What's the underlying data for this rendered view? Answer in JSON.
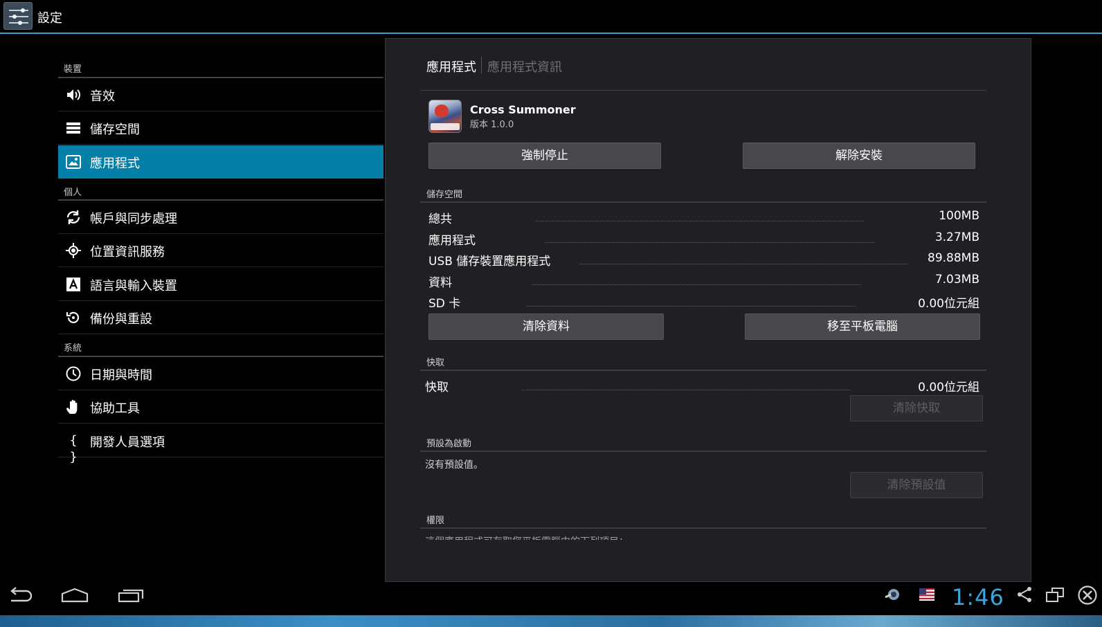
{
  "window": {
    "title": "設定"
  },
  "sidebar": {
    "sections": [
      {
        "header": "裝置"
      },
      {
        "header": "個人"
      },
      {
        "header": "系統"
      }
    ],
    "items": [
      {
        "label": "音效",
        "icon": "speaker-icon"
      },
      {
        "label": "儲存空間",
        "icon": "storage-icon"
      },
      {
        "label": "應用程式",
        "icon": "apps-icon",
        "selected": true
      },
      {
        "label": "帳戶與同步處理",
        "icon": "sync-icon"
      },
      {
        "label": "位置資訊服務",
        "icon": "location-icon"
      },
      {
        "label": "語言與輸入裝置",
        "icon": "language-icon"
      },
      {
        "label": "備份與重設",
        "icon": "backup-icon"
      },
      {
        "label": "日期與時間",
        "icon": "clock-icon"
      },
      {
        "label": "協助工具",
        "icon": "hand-icon"
      },
      {
        "label": "開發人員選項",
        "icon": "braces-icon"
      }
    ],
    "selected_color": "#0480a8"
  },
  "detail": {
    "breadcrumb": {
      "parent": "應用程式",
      "current": "應用程式資訊"
    },
    "app": {
      "name": "Cross Summoner",
      "version": "版本 1.0.0"
    },
    "buttons": {
      "force_stop": "強制停止",
      "uninstall": "解除安裝"
    },
    "storage": {
      "title": "儲存空間",
      "rows": [
        {
          "label": "總共",
          "value": "100MB"
        },
        {
          "label": "應用程式",
          "value": "3.27MB"
        },
        {
          "label": "USB 儲存裝置應用程式",
          "value": "89.88MB"
        },
        {
          "label": "資料",
          "value": "7.03MB"
        },
        {
          "label": "SD 卡",
          "value": "0.00位元組"
        }
      ],
      "clear_data": "清除資料",
      "move_to_tablet": "移至平板電腦"
    },
    "cache": {
      "title": "快取",
      "label": "快取",
      "value": "0.00位元組",
      "clear_cache": "清除快取"
    },
    "launch_default": {
      "title": "預設為啟動",
      "text": "沒有預設值。",
      "clear_defaults": "清除預設值"
    },
    "permissions": {
      "title": "權限",
      "text": "這個應用程式可存取您平板電腦中的下列項目："
    }
  },
  "system_bar": {
    "time": "1:46",
    "icons": [
      "back-icon",
      "home-icon",
      "recent-apps-icon",
      "notification-icon",
      "us-flag-icon",
      "share-icon",
      "window-icon",
      "close-icon"
    ],
    "accent": "#3aa6db"
  }
}
